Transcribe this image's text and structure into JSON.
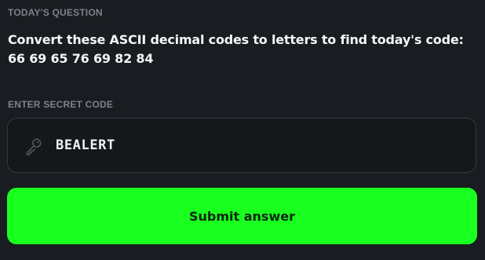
{
  "question": {
    "label": "TODAY'S QUESTION",
    "text": "Convert these ASCII decimal codes to letters to find today's code: 66 69 65 76 69 82 84"
  },
  "code_entry": {
    "label": "ENTER SECRET CODE",
    "value": "BEALERT",
    "icon": "key-icon"
  },
  "submit": {
    "label": "Submit answer"
  },
  "colors": {
    "background": "#191c20",
    "label": "#7c838c",
    "text": "#f4f5f7",
    "input_border": "#343941",
    "accent": "#19ff1e"
  }
}
